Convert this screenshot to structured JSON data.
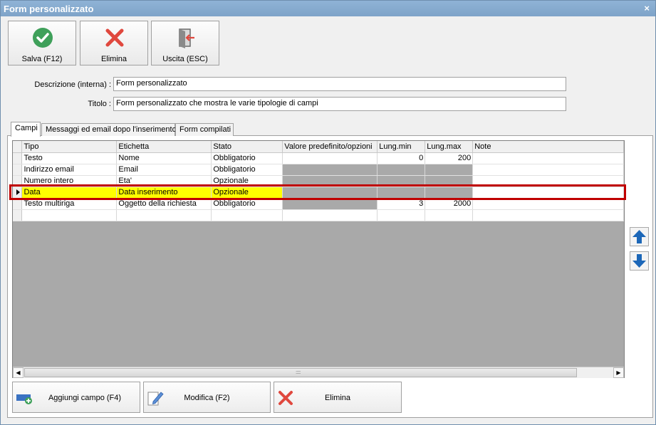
{
  "window": {
    "title": "Form personalizzato",
    "close_label": "×"
  },
  "toolbar": {
    "save_label": "Salva (F12)",
    "delete_label": "Elimina",
    "exit_label": "Uscita (ESC)"
  },
  "form": {
    "description_label": "Descrizione (interna) :",
    "description_value": "Form personalizzato",
    "title_label": "Titolo :",
    "title_value": "Form personalizzato che mostra le varie tipologie di campi"
  },
  "tabs": [
    {
      "label": "Campi"
    },
    {
      "label": "Messaggi ed email dopo l'inserimento"
    },
    {
      "label": "Form compilati"
    }
  ],
  "grid": {
    "columns": [
      "Tipo",
      "Etichetta",
      "Stato",
      "Valore predefinito/opzioni",
      "Lung.min",
      "Lung.max",
      "Note"
    ],
    "rows": [
      [
        "Testo",
        "Nome",
        "Obbligatorio",
        "",
        "0",
        "200",
        ""
      ],
      [
        "Indirizzo email",
        "Email",
        "Obbligatorio",
        "",
        "",
        "",
        ""
      ],
      [
        "Numero intero",
        "Eta'",
        "Opzionale",
        "",
        "",
        "",
        ""
      ],
      [
        "Data",
        "Data inserimento",
        "Opzionale",
        "",
        "",
        "",
        ""
      ],
      [
        "Testo multiriga",
        "Oggetto della richiesta",
        "Obbligatorio",
        "",
        "3",
        "2000",
        ""
      ],
      [
        "",
        "",
        "",
        "",
        "",
        "",
        ""
      ]
    ],
    "selected_row": 3
  },
  "bottom_buttons": {
    "add_label": "Aggiungi campo (F4)",
    "edit_label": "Modifica (F2)",
    "delete_label": "Elimina"
  },
  "colors": {
    "title_bar": "#7ea3c8",
    "highlight_border": "#c00000",
    "selected_fill": "#ffff00",
    "save_icon": "#3fa05a",
    "delete_icon": "#e0483e",
    "arrow_icon": "#1c67b8"
  }
}
